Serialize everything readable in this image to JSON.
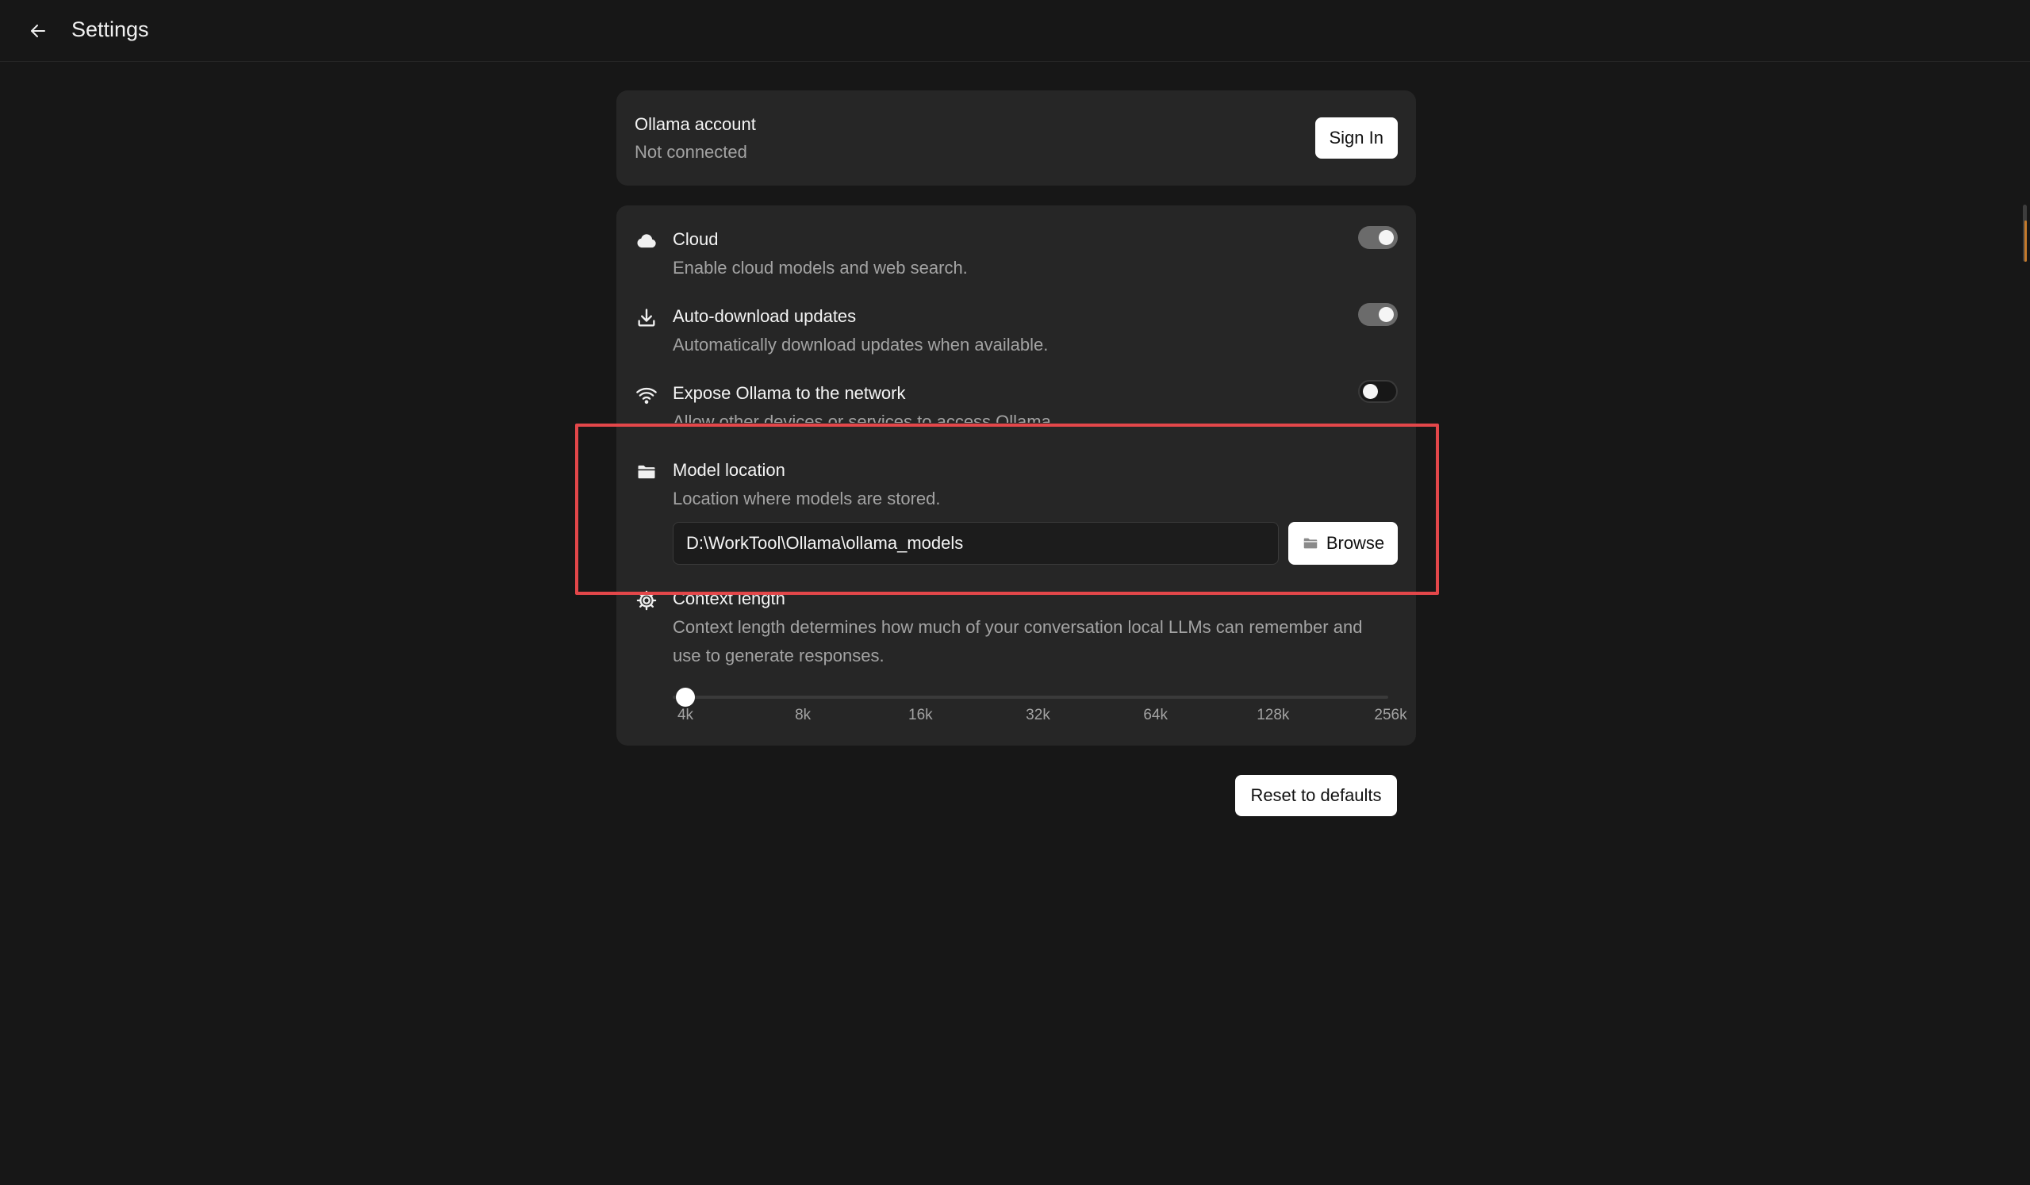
{
  "header": {
    "title": "Settings",
    "back_icon": "arrow-left-icon"
  },
  "account": {
    "title": "Ollama account",
    "status": "Not connected",
    "sign_in_label": "Sign In"
  },
  "settings": {
    "cloud": {
      "icon": "cloud-icon",
      "title": "Cloud",
      "description": "Enable cloud models and web search.",
      "enabled": true
    },
    "auto_download": {
      "icon": "download-icon",
      "title": "Auto-download updates",
      "description": "Automatically download updates when available.",
      "enabled": true
    },
    "expose_network": {
      "icon": "wifi-icon",
      "title": "Expose Ollama to the network",
      "description": "Allow other devices or services to access Ollama.",
      "enabled": false
    },
    "model_location": {
      "icon": "folder-icon",
      "title": "Model location",
      "description": "Location where models are stored.",
      "path_value": "D:\\WorkTool\\Ollama\\ollama_models",
      "browse_label": "Browse",
      "browse_icon": "folder-icon"
    },
    "context_length": {
      "icon": "gear-icon",
      "title": "Context length",
      "description_line1": "Context length determines how much of your conversation local LLMs can remember and",
      "description_line2": "use to generate responses.",
      "ticks": [
        "4k",
        "8k",
        "16k",
        "32k",
        "64k",
        "128k",
        "256k"
      ],
      "selected_index": 0
    }
  },
  "reset_label": "Reset to defaults",
  "colors": {
    "background": "#171717",
    "card": "#262626",
    "highlight": "#e3474a",
    "scroll_accent": "#c47a2c"
  }
}
